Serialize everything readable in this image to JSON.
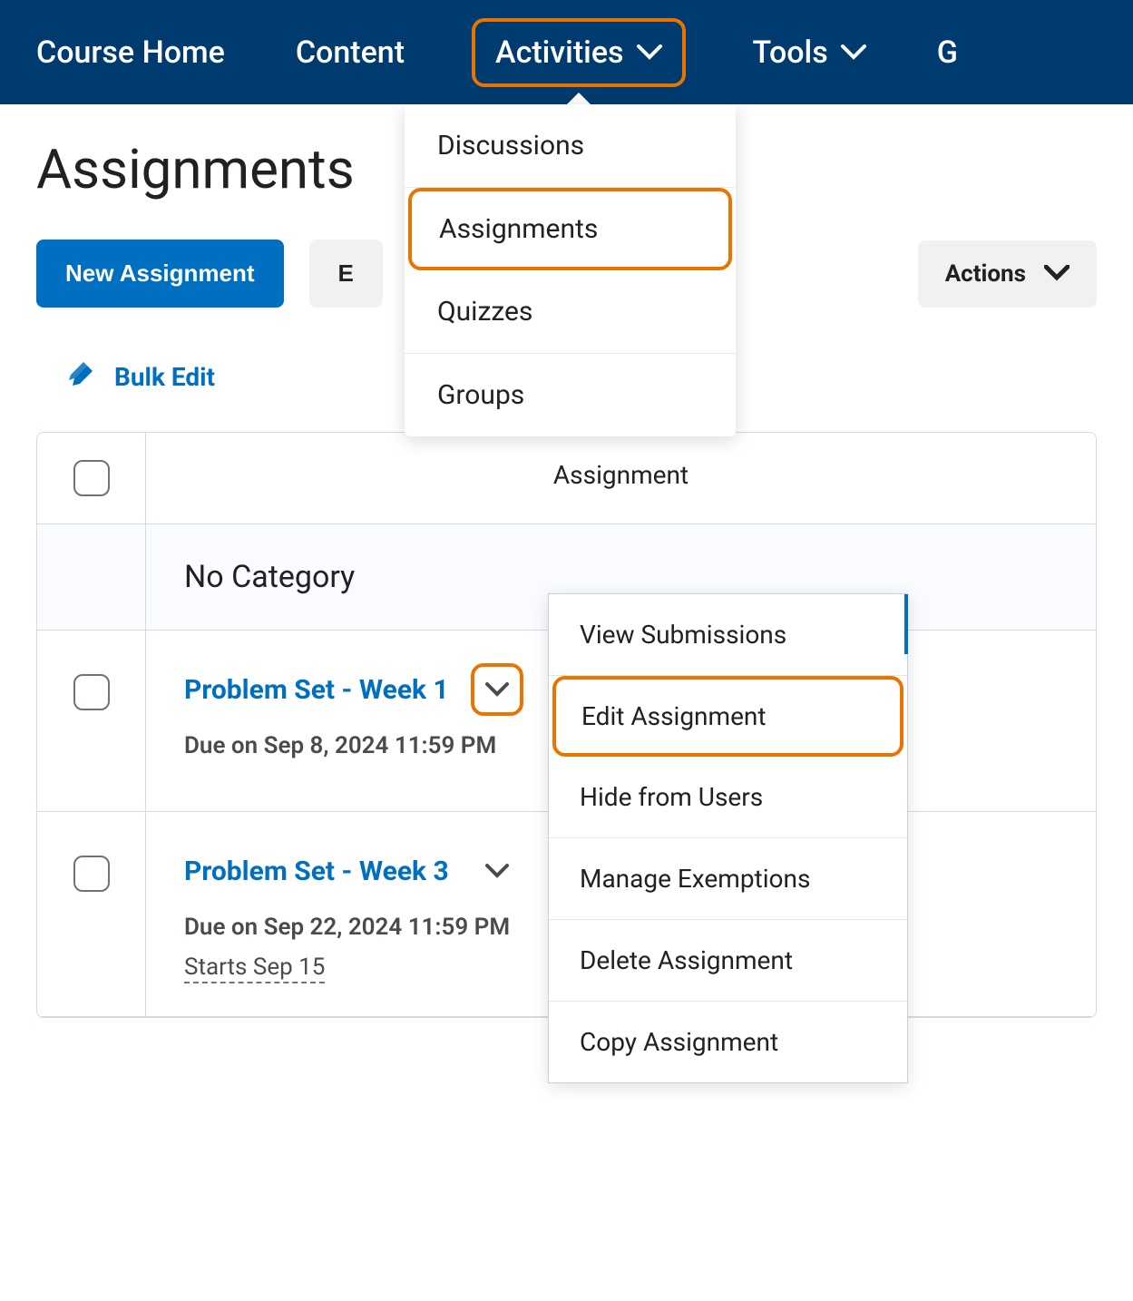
{
  "nav": {
    "course_home": "Course Home",
    "content": "Content",
    "activities": "Activities",
    "tools": "Tools",
    "grades_partial": "G"
  },
  "activities_menu": {
    "discussions": "Discussions",
    "assignments": "Assignments",
    "quizzes": "Quizzes",
    "groups": "Groups"
  },
  "page_title": "Assignments",
  "buttons": {
    "new_assignment": "New Assignment",
    "edit_categories_partial": "E",
    "more_actions": "Actions"
  },
  "bulk_edit": "Bulk Edit",
  "table": {
    "header_assignment": "Assignment",
    "no_category": "No Category",
    "rows": [
      {
        "title": "Problem Set - Week 1",
        "due": "Due on Sep 8, 2024 11:59 PM"
      },
      {
        "title": "Problem Set - Week 3",
        "due": "Due on Sep 22, 2024 11:59 PM",
        "starts": "Starts Sep 15"
      }
    ]
  },
  "context_menu": {
    "view_submissions": "View Submissions",
    "edit_assignment": "Edit Assignment",
    "hide_from_users": "Hide from Users",
    "manage_exemptions": "Manage Exemptions",
    "delete_assignment": "Delete Assignment",
    "copy_assignment": "Copy Assignment"
  }
}
